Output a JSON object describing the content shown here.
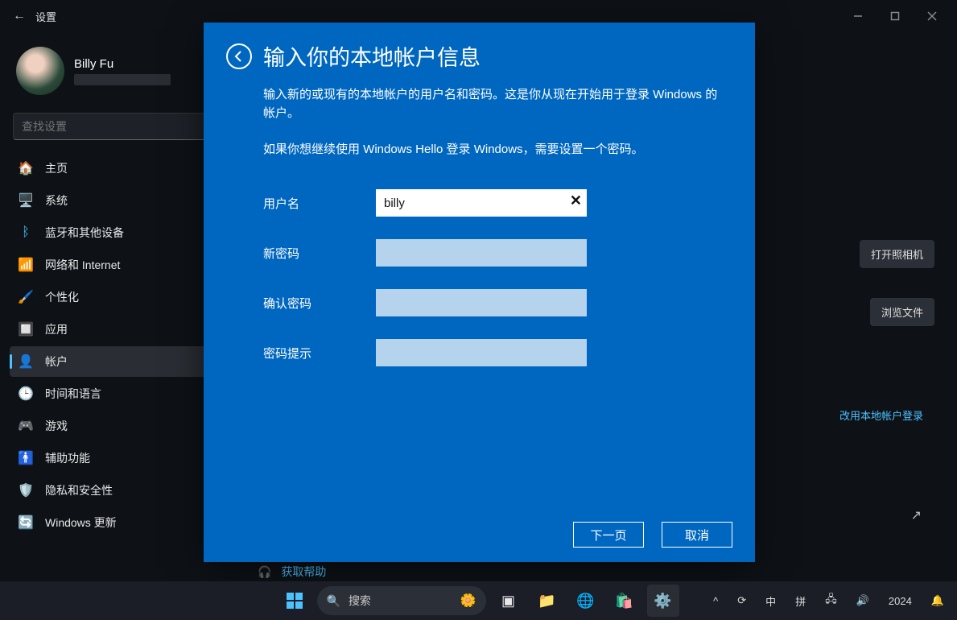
{
  "titlebar": {
    "back_icon": "←",
    "title": "设置"
  },
  "user": {
    "name": "Billy Fu"
  },
  "search": {
    "placeholder": "查找设置"
  },
  "sidebar": {
    "items": [
      {
        "label": "主页",
        "icon": "🏠"
      },
      {
        "label": "系统",
        "icon": "🖥️"
      },
      {
        "label": "蓝牙和其他设备",
        "icon": "ᛒ"
      },
      {
        "label": "网络和 Internet",
        "icon": "📶"
      },
      {
        "label": "个性化",
        "icon": "🖌️"
      },
      {
        "label": "应用",
        "icon": "🔲"
      },
      {
        "label": "帐户",
        "icon": "👤"
      },
      {
        "label": "时间和语言",
        "icon": "🕒"
      },
      {
        "label": "游戏",
        "icon": "🎮"
      },
      {
        "label": "辅助功能",
        "icon": "🚹"
      },
      {
        "label": "隐私和安全性",
        "icon": "🛡️"
      },
      {
        "label": "Windows 更新",
        "icon": "🔄"
      }
    ],
    "active_index": 6
  },
  "content_actions": {
    "camera": "打开照相机",
    "browse": "浏览文件",
    "local_signin": "改用本地帐户登录"
  },
  "help": {
    "label": "获取帮助"
  },
  "dialog": {
    "title": "输入你的本地帐户信息",
    "desc": "输入新的或现有的本地帐户的用户名和密码。这是你从现在开始用于登录 Windows 的帐户。",
    "desc2": "如果你想继续使用 Windows Hello 登录 Windows，需要设置一个密码。",
    "fields": {
      "username_label": "用户名",
      "username_value": "billy",
      "newpw_label": "新密码",
      "confirmpw_label": "确认密码",
      "hint_label": "密码提示"
    },
    "buttons": {
      "next": "下一页",
      "cancel": "取消"
    }
  },
  "taskbar": {
    "search_label": "搜索",
    "tray": {
      "ime1": "中",
      "ime2": "拼",
      "year": "2024"
    }
  }
}
